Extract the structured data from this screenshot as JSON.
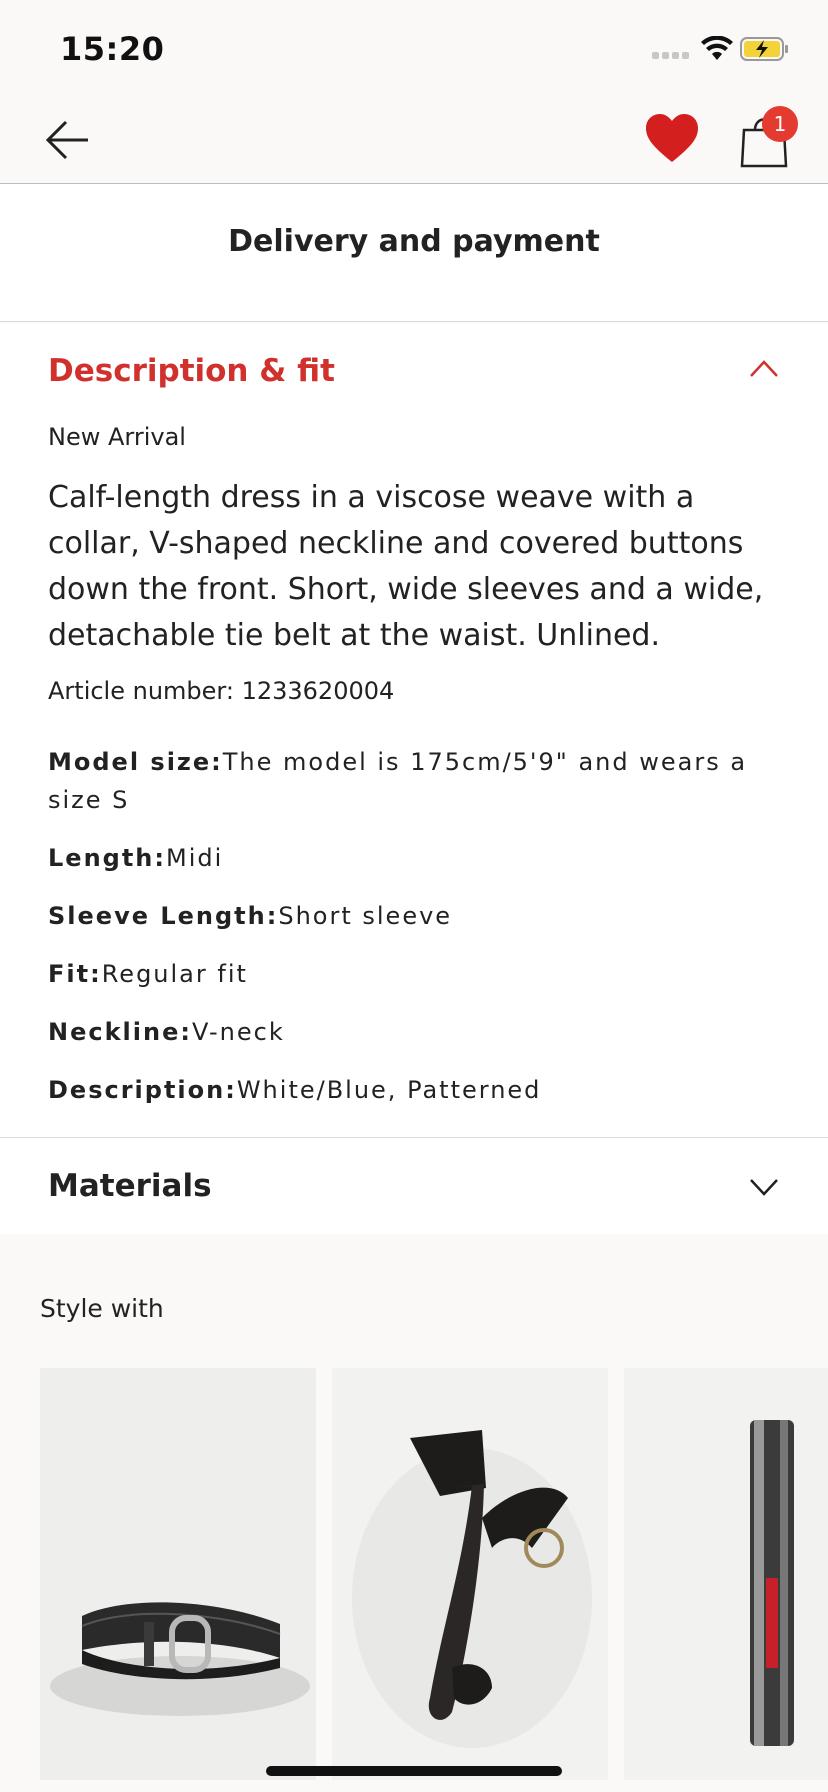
{
  "status_bar": {
    "time": "15:20"
  },
  "nav": {
    "bag_count": "1"
  },
  "delivery": {
    "label": "Delivery and payment"
  },
  "description": {
    "title": "Description & fit",
    "tag": "New Arrival",
    "text": "Calf-length dress in a viscose weave with a collar, V-shaped neckline and covered buttons down the front. Short, wide sleeves and a wide, detachable tie belt at the waist. Unlined.",
    "article_number": "Article number: 1233620004",
    "attributes": [
      {
        "label": "Model size:",
        "value": "The model is 175cm/5'9\" and wears a size S"
      },
      {
        "label": "Length:",
        "value": "Midi"
      },
      {
        "label": "Sleeve Length:",
        "value": "Short sleeve"
      },
      {
        "label": "Fit:",
        "value": "Regular fit"
      },
      {
        "label": "Neckline:",
        "value": "V-neck"
      },
      {
        "label": "Description:",
        "value": "White/Blue, Patterned"
      }
    ]
  },
  "materials": {
    "title": "Materials"
  },
  "style_with": {
    "title": "Style with"
  },
  "colors": {
    "accent": "#d0312d",
    "badge": "#e53a2f"
  }
}
